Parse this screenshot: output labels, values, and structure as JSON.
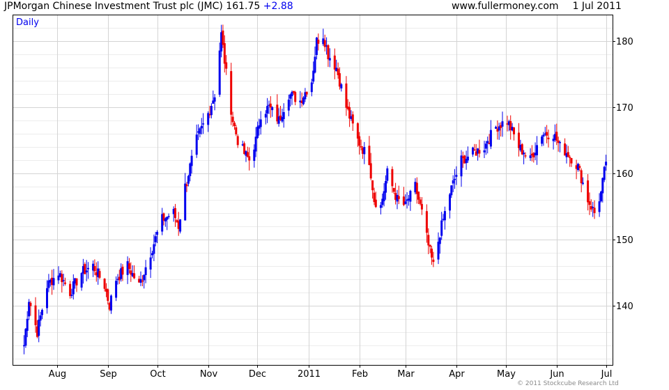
{
  "header": {
    "title": "JPMorgan Chinese Investment Trust plc (JMC)",
    "last_price": "161.75",
    "change": "+2.88",
    "site": "www.fullermoney.com",
    "date": "1 Jul 2011"
  },
  "footer": {
    "copyright": "© 2011 Stockcube Research Ltd"
  },
  "colors": {
    "up": "#0000ee",
    "down": "#ee0000",
    "grid": "#d4d4d4",
    "minor_grid": "#ececec",
    "axis": "#000000",
    "change_text": "#0000ee"
  },
  "chart_data": {
    "type": "line",
    "style": "ohlc-bars",
    "period_label": "Daily",
    "x_ticks": [
      "Aug",
      "Sep",
      "Oct",
      "Nov",
      "Dec",
      "2011",
      "Feb",
      "Mar",
      "Apr",
      "May",
      "Jun",
      "Jul"
    ],
    "y_ticks": [
      140,
      150,
      160,
      170,
      180
    ],
    "ylim": [
      131,
      184
    ],
    "y_axis_side": "right",
    "grid": true,
    "price_path": [
      [
        "2010-07-12",
        134
      ],
      [
        "2010-07-15",
        141
      ],
      [
        "2010-07-20",
        136
      ],
      [
        "2010-07-26",
        143
      ],
      [
        "2010-08-02",
        145
      ],
      [
        "2010-08-09",
        142
      ],
      [
        "2010-08-16",
        145
      ],
      [
        "2010-08-23",
        146
      ],
      [
        "2010-08-30",
        143
      ],
      [
        "2010-09-02",
        140
      ],
      [
        "2010-09-06",
        144
      ],
      [
        "2010-09-13",
        146
      ],
      [
        "2010-09-20",
        143
      ],
      [
        "2010-09-27",
        148
      ],
      [
        "2010-10-04",
        153
      ],
      [
        "2010-10-11",
        154
      ],
      [
        "2010-10-14",
        152
      ],
      [
        "2010-10-18",
        158
      ],
      [
        "2010-10-25",
        165
      ],
      [
        "2010-11-01",
        169
      ],
      [
        "2010-11-05",
        172
      ],
      [
        "2010-11-09",
        181
      ],
      [
        "2010-11-12",
        175
      ],
      [
        "2010-11-16",
        168
      ],
      [
        "2010-11-19",
        165
      ],
      [
        "2010-11-23",
        163
      ],
      [
        "2010-11-26",
        162
      ],
      [
        "2010-11-30",
        165
      ],
      [
        "2010-12-03",
        169
      ],
      [
        "2010-12-08",
        170
      ],
      [
        "2010-12-14",
        168
      ],
      [
        "2010-12-20",
        172
      ],
      [
        "2010-12-27",
        171
      ],
      [
        "2011-01-03",
        174
      ],
      [
        "2011-01-06",
        180
      ],
      [
        "2011-01-10",
        181
      ],
      [
        "2011-01-13",
        178
      ],
      [
        "2011-01-18",
        176
      ],
      [
        "2011-01-24",
        170
      ],
      [
        "2011-01-31",
        165
      ],
      [
        "2011-02-07",
        162
      ],
      [
        "2011-02-10",
        156
      ],
      [
        "2011-02-14",
        155
      ],
      [
        "2011-02-18",
        160
      ],
      [
        "2011-02-24",
        156
      ],
      [
        "2011-03-01",
        155
      ],
      [
        "2011-03-07",
        158
      ],
      [
        "2011-03-11",
        154
      ],
      [
        "2011-03-15",
        149
      ],
      [
        "2011-03-18",
        146
      ],
      [
        "2011-03-22",
        151
      ],
      [
        "2011-03-28",
        157
      ],
      [
        "2011-04-04",
        162
      ],
      [
        "2011-04-11",
        163
      ],
      [
        "2011-04-18",
        164
      ],
      [
        "2011-04-25",
        167
      ],
      [
        "2011-05-02",
        168
      ],
      [
        "2011-05-09",
        164
      ],
      [
        "2011-05-16",
        162
      ],
      [
        "2011-05-23",
        166
      ],
      [
        "2011-05-30",
        166
      ],
      [
        "2011-06-03",
        164
      ],
      [
        "2011-06-08",
        163
      ],
      [
        "2011-06-14",
        161
      ],
      [
        "2011-06-20",
        156
      ],
      [
        "2011-06-24",
        154
      ],
      [
        "2011-06-28",
        157
      ],
      [
        "2011-07-01",
        161.75
      ]
    ]
  }
}
